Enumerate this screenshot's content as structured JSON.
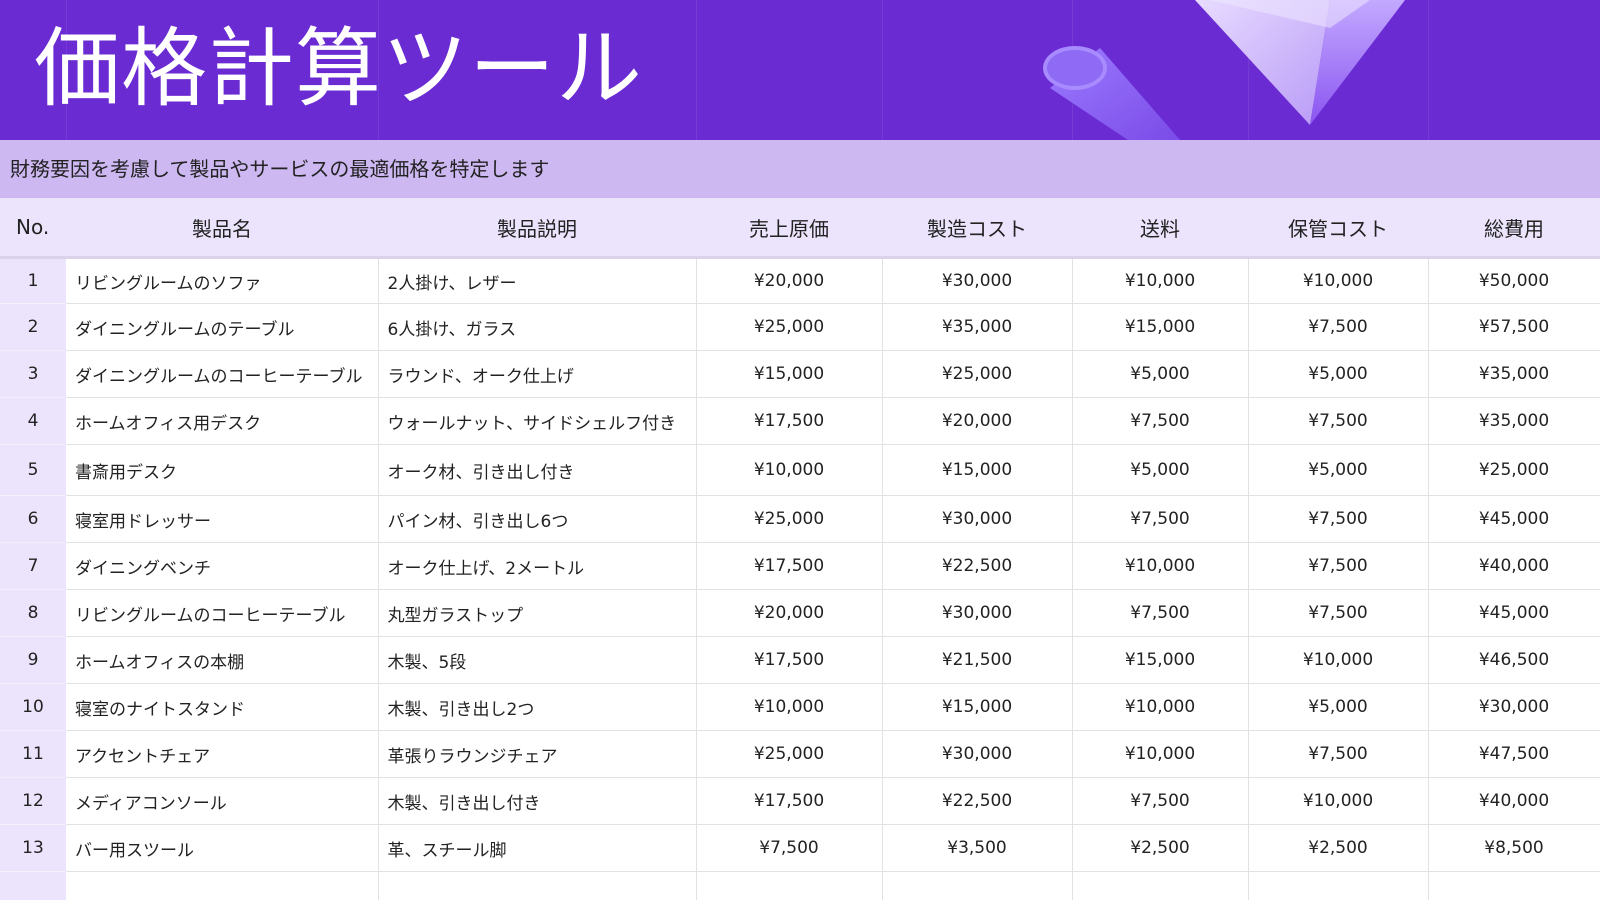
{
  "header": {
    "title": "価格計算ツール",
    "subtitle": "財務要因を考慮して製品やサービスの最適価格を特定します"
  },
  "colors": {
    "banner": "#6a2cd2",
    "subtitle_bar": "#cdb8f2",
    "header_row": "#ece4fc",
    "decoration": "#a07cf5"
  },
  "table": {
    "columns": [
      "No.",
      "製品名",
      "製品説明",
      "売上原価",
      "製造コスト",
      "送料",
      "保管コスト",
      "総費用"
    ],
    "rows": [
      [
        "1",
        "リビングルームのソファ",
        "2人掛け、レザー",
        "¥20,000",
        "¥30,000",
        "¥10,000",
        "¥10,000",
        "¥50,000"
      ],
      [
        "2",
        "ダイニングルームのテーブル",
        "6人掛け、ガラス",
        "¥25,000",
        "¥35,000",
        "¥15,000",
        "¥7,500",
        "¥57,500"
      ],
      [
        "3",
        "ダイニングルームのコーヒーテーブル",
        "ラウンド、オーク仕上げ",
        "¥15,000",
        "¥25,000",
        "¥5,000",
        "¥5,000",
        "¥35,000"
      ],
      [
        "4",
        "ホームオフィス用デスク",
        "ウォールナット、サイドシェルフ付き",
        "¥17,500",
        "¥20,000",
        "¥7,500",
        "¥7,500",
        "¥35,000"
      ],
      [
        "5",
        "書斎用デスク",
        "オーク材、引き出し付き",
        "¥10,000",
        "¥15,000",
        "¥5,000",
        "¥5,000",
        "¥25,000"
      ],
      [
        "6",
        "寝室用ドレッサー",
        "パイン材、引き出し6つ",
        "¥25,000",
        "¥30,000",
        "¥7,500",
        "¥7,500",
        "¥45,000"
      ],
      [
        "7",
        "ダイニングベンチ",
        "オーク仕上げ、2メートル",
        "¥17,500",
        "¥22,500",
        "¥10,000",
        "¥7,500",
        "¥40,000"
      ],
      [
        "8",
        "リビングルームのコーヒーテーブル",
        "丸型ガラストップ",
        "¥20,000",
        "¥30,000",
        "¥7,500",
        "¥7,500",
        "¥45,000"
      ],
      [
        "9",
        "ホームオフィスの本棚",
        "木製、5段",
        "¥17,500",
        "¥21,500",
        "¥15,000",
        "¥10,000",
        "¥46,500"
      ],
      [
        "10",
        "寝室のナイトスタンド",
        "木製、引き出し2つ",
        "¥10,000",
        "¥15,000",
        "¥10,000",
        "¥5,000",
        "¥30,000"
      ],
      [
        "11",
        "アクセントチェア",
        "革張りラウンジチェア",
        "¥25,000",
        "¥30,000",
        "¥10,000",
        "¥7,500",
        "¥47,500"
      ],
      [
        "12",
        "メディアコンソール",
        "木製、引き出し付き",
        "¥17,500",
        "¥22,500",
        "¥7,500",
        "¥10,000",
        "¥40,000"
      ],
      [
        "13",
        "バー用スツール",
        "革、スチール脚",
        "¥7,500",
        "¥3,500",
        "¥2,500",
        "¥2,500",
        "¥8,500"
      ]
    ]
  }
}
